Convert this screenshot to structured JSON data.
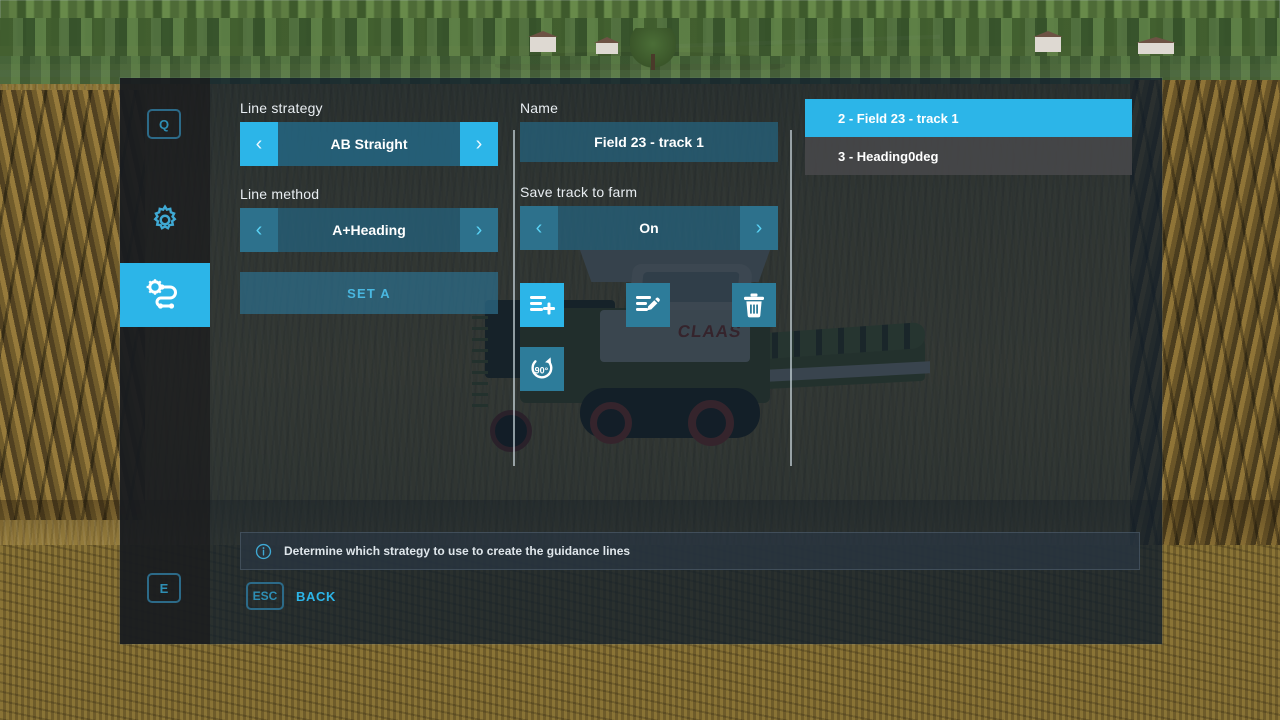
{
  "sidebar": {
    "key_top": {
      "label": "Q",
      "name": "prev-tab-key"
    },
    "key_bottom": {
      "label": "E",
      "name": "next-tab-key"
    },
    "tabs": [
      {
        "label": "Settings",
        "icon": "gear-icon",
        "active": false
      },
      {
        "label": "Guidance",
        "icon": "guidance-track-icon",
        "active": true
      }
    ]
  },
  "left_column": {
    "line_strategy": {
      "label": "Line strategy",
      "value": "AB Straight",
      "prev_arrow": "‹",
      "next_arrow": "›"
    },
    "line_method": {
      "label": "Line method",
      "value": "A+Heading",
      "prev_arrow": "‹",
      "next_arrow": "›"
    },
    "set_a_button": {
      "label": "SET A"
    }
  },
  "center_column": {
    "name": {
      "label": "Name",
      "value": "Field 23 - track 1"
    },
    "save_track_to_farm": {
      "label": "Save track to farm",
      "value": "On",
      "prev_arrow": "‹",
      "next_arrow": "›"
    },
    "actions": [
      {
        "name": "create-track-button",
        "icon": "list-add-icon",
        "primary": true
      },
      {
        "name": "rename-track-button",
        "icon": "list-edit-icon",
        "primary": false
      },
      {
        "name": "delete-track-button",
        "icon": "trash-icon",
        "primary": false
      },
      {
        "name": "rotate-90-button",
        "icon": "rotate-90-icon",
        "primary": false
      }
    ],
    "rotate_label": "90°"
  },
  "track_list": {
    "items": [
      {
        "label": "2 - Field 23 - track 1",
        "selected": true
      },
      {
        "label": "3 - Heading0deg",
        "selected": false
      }
    ]
  },
  "info_bar": {
    "icon": "info-icon",
    "text": "Determine which strategy to use to create the guidance lines"
  },
  "back": {
    "key": "ESC",
    "label": "BACK"
  },
  "colors": {
    "accent": "#2cb5e8",
    "accent_muted": "#2d7c9a",
    "panel_bg": "#121f2d",
    "field_bg": "#265f78",
    "text": "#ffffff",
    "label_text": "#e9eef2",
    "link": "#2e8fb5"
  }
}
